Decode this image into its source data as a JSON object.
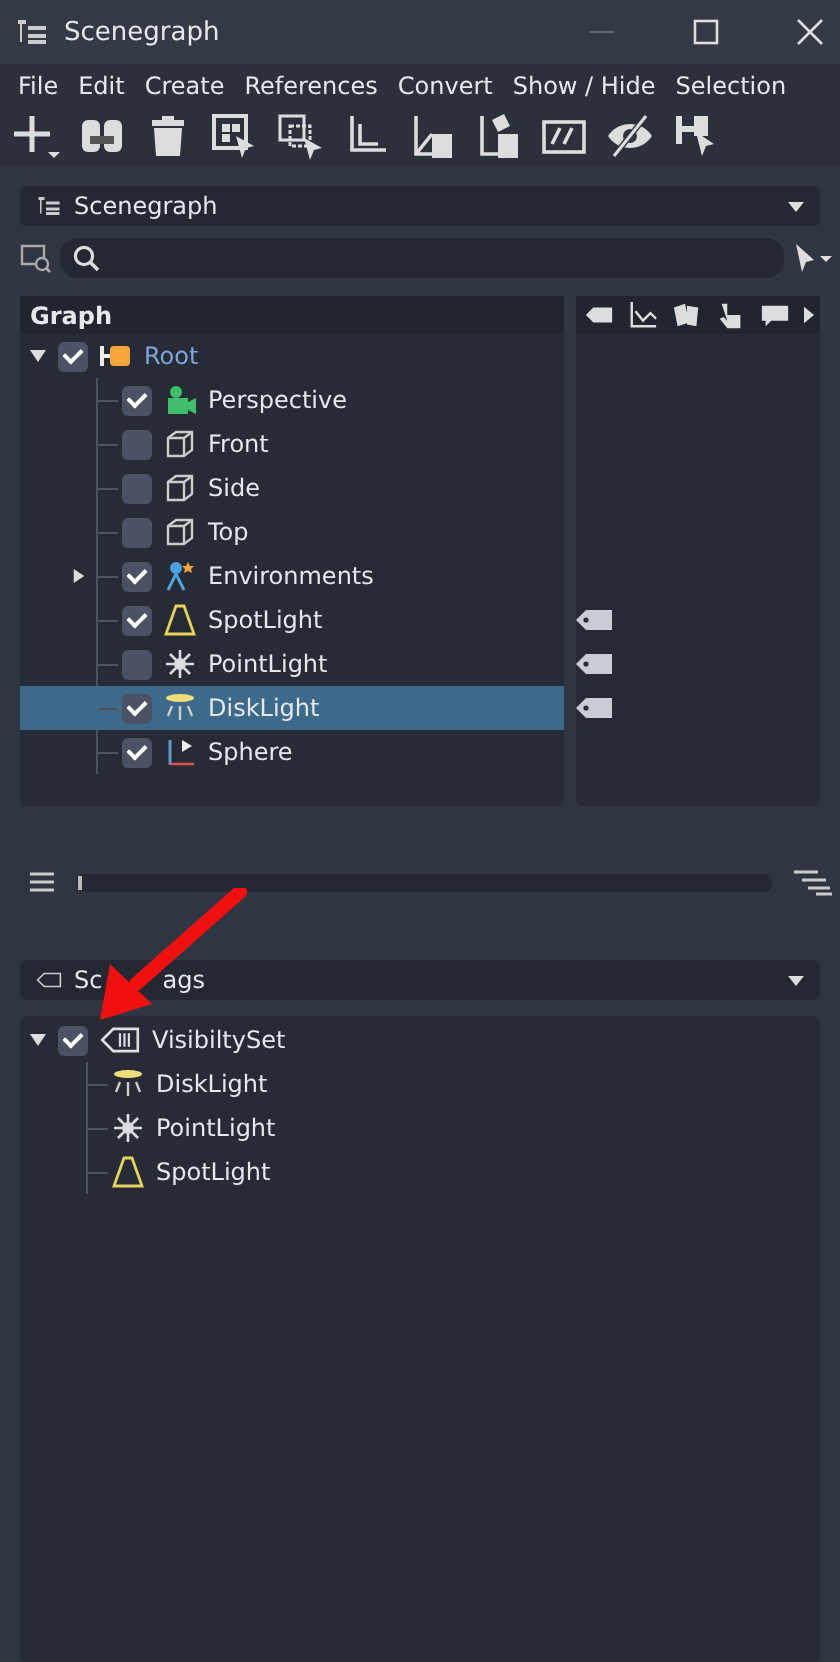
{
  "window": {
    "title": "Scenegraph"
  },
  "menu": [
    "File",
    "Edit",
    "Create",
    "References",
    "Convert",
    "Show / Hide",
    "Selection"
  ],
  "scenegraph": {
    "dropdown": "Scenegraph",
    "header": "Graph",
    "root": {
      "label": "Root",
      "checked": true,
      "expanded": true,
      "children": [
        {
          "label": "Perspective",
          "kind": "camera",
          "checked": true,
          "selected": false,
          "tagged": false
        },
        {
          "label": "Front",
          "kind": "view",
          "checked": false,
          "selected": false,
          "tagged": false
        },
        {
          "label": "Side",
          "kind": "view",
          "checked": false,
          "selected": false,
          "tagged": false
        },
        {
          "label": "Top",
          "kind": "view",
          "checked": false,
          "selected": false,
          "tagged": false
        },
        {
          "label": "Environments",
          "kind": "environment",
          "checked": true,
          "selected": false,
          "tagged": false,
          "expanded": false
        },
        {
          "label": "SpotLight",
          "kind": "spot",
          "checked": true,
          "selected": false,
          "tagged": true
        },
        {
          "label": "PointLight",
          "kind": "point",
          "checked": false,
          "selected": false,
          "tagged": true
        },
        {
          "label": "DiskLight",
          "kind": "disk",
          "checked": true,
          "selected": true,
          "tagged": true
        },
        {
          "label": "Sphere",
          "kind": "geometry",
          "checked": true,
          "selected": false,
          "tagged": false
        }
      ]
    }
  },
  "scene_tags": {
    "dropdown_visible_parts": [
      "Sc",
      "ags"
    ],
    "set": {
      "label": "VisibiltySet",
      "checked": true,
      "expanded": true,
      "children": [
        {
          "label": "DiskLight",
          "kind": "disk"
        },
        {
          "label": "PointLight",
          "kind": "point"
        },
        {
          "label": "SpotLight",
          "kind": "spot"
        }
      ]
    }
  }
}
